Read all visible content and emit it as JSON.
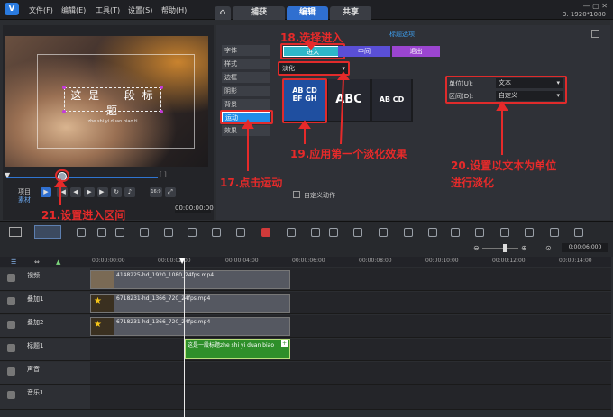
{
  "app": {
    "logo": "V",
    "resolution": "3. 1920*1080"
  },
  "menu": [
    "文件(F)",
    "编辑(E)",
    "工具(T)",
    "设置(S)",
    "帮助(H)"
  ],
  "tabs": {
    "home_icon": "home-icon",
    "capture": "捕获",
    "edit": "编辑",
    "share": "共享"
  },
  "preview": {
    "title_text": "这 是 一 段 标 题",
    "subtitle_text": "zhe shi yi duan biao ti",
    "mode_project": "项目",
    "mode_clip": "素材",
    "timecode": "00:00:00:00",
    "zoom": "16:9"
  },
  "panel": {
    "header": "标题选项",
    "categories": [
      "字体",
      "样式",
      "边框",
      "阴影",
      "背景",
      "运动",
      "效果"
    ],
    "active_category": "运动",
    "in_button": "进入",
    "mid_button": "中间",
    "out_button": "退出",
    "effect_type": "淡化",
    "thumbs": [
      {
        "line1": "AB CD",
        "line2": "EF GH"
      },
      {
        "line1": "ABC",
        "line2": ""
      },
      {
        "line1": "AB CD",
        "line2": ""
      }
    ],
    "unit_label": "单位(U):",
    "unit_value": "文本",
    "range_label": "区间(D):",
    "range_value": "自定义",
    "custom_motion": "自定义动作"
  },
  "annotations": {
    "a17": "17.点击运动",
    "a18": "18.选择进入",
    "a19": "19.应用第一个淡化效果",
    "a20_1": "20.设置以文本为单位",
    "a20_2": "进行淡化",
    "a21": "21.设置进入区间"
  },
  "timeline": {
    "zoom_time": "0:00:06:000",
    "ruler": [
      "00:00:00:00",
      "00:00:02:00",
      "00:00:04:00",
      "00:00:06:00",
      "00:00:08:00",
      "00:00:10:00",
      "00:00:12:00",
      "00:00:14:00"
    ],
    "tracks": [
      {
        "name": "视频",
        "clip": "4148225-hd_1920_1080_24fps.mp4"
      },
      {
        "name": "叠加1",
        "clip": "6718231-hd_1366_720_24fps.mp4"
      },
      {
        "name": "叠加2",
        "clip": "6718231-hd_1366_720_24fps.mp4"
      },
      {
        "name": "标题1",
        "clip": "这是一段标题zhe shi yi duan biao"
      },
      {
        "name": "声音",
        "clip": ""
      },
      {
        "name": "音乐1",
        "clip": ""
      }
    ]
  },
  "colors": {
    "accent": "#2f6fd0",
    "annotation": "#e62a2a",
    "title_clip": "#2e8f2a"
  }
}
